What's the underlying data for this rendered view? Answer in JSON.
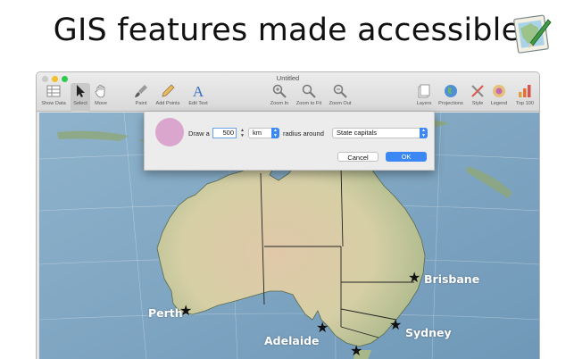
{
  "headline": "GIS features made accessible",
  "window": {
    "title": "Untitled"
  },
  "toolbar": {
    "items": [
      {
        "label": "Show Data",
        "icon": "table-icon"
      },
      {
        "label": "Select",
        "icon": "arrow-pointer-icon",
        "selected": true
      },
      {
        "label": "Move",
        "icon": "hand-icon"
      },
      {
        "label": "Paint",
        "icon": "paint-brush-icon"
      },
      {
        "label": "Add Points",
        "icon": "pencil-icon"
      },
      {
        "label": "Edit Text",
        "icon": "text-a-icon"
      },
      {
        "label": "Zoom In",
        "icon": "zoom-in-icon"
      },
      {
        "label": "Zoom to Fit",
        "icon": "zoom-fit-icon"
      },
      {
        "label": "Zoom Out",
        "icon": "zoom-out-icon"
      },
      {
        "label": "Layers",
        "icon": "layers-icon"
      },
      {
        "label": "Projections",
        "icon": "globe-icon"
      },
      {
        "label": "Style",
        "icon": "style-icon"
      },
      {
        "label": "Legend",
        "icon": "legend-icon"
      },
      {
        "label": "Top 100",
        "icon": "bar-chart-icon"
      }
    ]
  },
  "dialog": {
    "swatch_color": "#dba6cd",
    "draw_label": "Draw a",
    "distance_value": "500",
    "unit_selected": "km",
    "radius_label": "radius around",
    "target_selected": "State capitals",
    "cancel_label": "Cancel",
    "ok_label": "OK"
  },
  "map": {
    "cities": [
      {
        "name": "Perth"
      },
      {
        "name": "Adelaide"
      },
      {
        "name": "Sydney"
      },
      {
        "name": "Brisbane"
      }
    ]
  },
  "colors": {
    "accent": "#3b87f3",
    "ocean": "#7ea6c4",
    "land": "#d8cfae"
  }
}
